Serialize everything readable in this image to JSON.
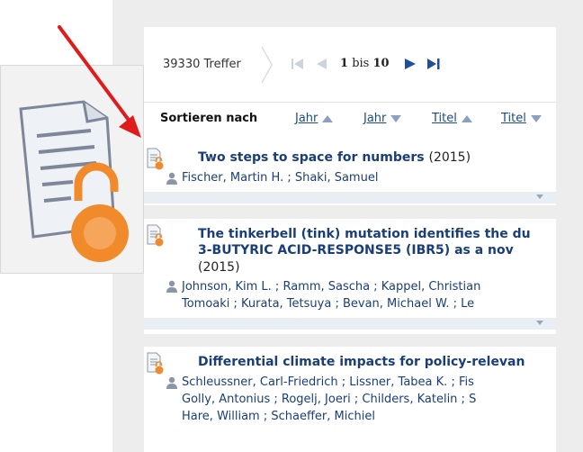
{
  "pager": {
    "hits_text": "39330 Treffer",
    "range_start": "1",
    "range_sep": "bis",
    "range_end": "10"
  },
  "sort": {
    "label": "Sortieren nach",
    "options": [
      {
        "label": "Jahr",
        "direction": "ascending"
      },
      {
        "label": "Jahr",
        "direction": "descending"
      },
      {
        "label": "Titel",
        "direction": "ascending"
      },
      {
        "label": "Titel",
        "direction": "descending"
      }
    ]
  },
  "results": [
    {
      "title_lines": [
        "Two steps to space for numbers"
      ],
      "year": "(2015)",
      "author_lines": [
        "Fischer, Martin H. ; Shaki, Samuel"
      ]
    },
    {
      "title_lines": [
        "The tinkerbell (tink) mutation identifies the du",
        "3-BUTYRIC ACID-RESPONSE5 (IBR5) as a nov"
      ],
      "year": "(2015)",
      "author_lines": [
        "Johnson, Kim L. ; Ramm, Sascha ; Kappel, Christian",
        "Tomoaki ; Kurata, Tetsuya ; Bevan, Michael W. ; Le"
      ]
    },
    {
      "title_lines": [
        "Differential climate impacts for policy-relevan"
      ],
      "year": "",
      "author_lines": [
        "Schleussner, Carl-Friedrich ; Lissner, Tabea K. ; Fis",
        "Golly, Antonius ; Rogelj, Joeri ; Childers, Katelin ; S",
        "Hare, William ; Schaeffer, Michiel"
      ]
    }
  ],
  "icons": {
    "document": "document-lock-icon",
    "person": "person-icon",
    "first": "first-page-icon",
    "prev": "prev-page-icon",
    "next": "next-page-icon",
    "last": "last-page-icon"
  },
  "colors": {
    "link": "#1a3e78",
    "arrow": "#e01b1b",
    "lock": "#f08a2a",
    "pager_active": "#1f4f9a"
  }
}
